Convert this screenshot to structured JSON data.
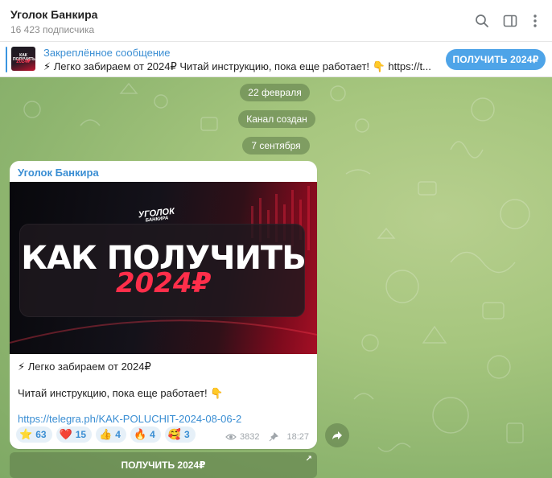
{
  "header": {
    "title": "Уголок Банкира",
    "subscribers": "16 423 подписчика",
    "icons": [
      "search-icon",
      "sidebar-toggle-icon",
      "more-vertical-icon"
    ]
  },
  "pinned": {
    "title": "Закреплённое сообщение",
    "text": "⚡ Легко забираем от 2024₽  Читай инструкцию, пока еще работает! 👇  https://t...",
    "thumb_line1": "КАК ПОЛУЧИТЬ",
    "thumb_line2": "2024₽",
    "button": "ПОЛУЧИТЬ 2024₽"
  },
  "service": {
    "date1": "22 февраля",
    "created": "Канал создан",
    "date2": "7 сентября"
  },
  "message": {
    "author": "Уголок Банкира",
    "image": {
      "logo_top": "УГОЛОК",
      "logo_bottom": "БАНКИРА",
      "headline": "КАК ПОЛУЧИТЬ",
      "amount": "2024₽"
    },
    "line1": "⚡ Легко забираем от 2024₽",
    "line2": "Читай инструкцию, пока еще работает! 👇",
    "link": "https://telegra.ph/KAK-POLUCHIT-2024-08-06-2",
    "reactions": [
      {
        "emoji": "⭐",
        "count": "63"
      },
      {
        "emoji": "❤️",
        "count": "15"
      },
      {
        "emoji": "👍",
        "count": "4"
      },
      {
        "emoji": "🔥",
        "count": "4"
      },
      {
        "emoji": "🥰",
        "count": "3"
      }
    ],
    "views": "3832",
    "time": "18:27"
  },
  "inline_button": "ПОЛУЧИТЬ 2024₽",
  "colors": {
    "accent": "#3a8ed3",
    "pin_button": "#4ea4e8",
    "chat_bg": "#a6c67e",
    "amount_red": "#ff2e4a"
  }
}
